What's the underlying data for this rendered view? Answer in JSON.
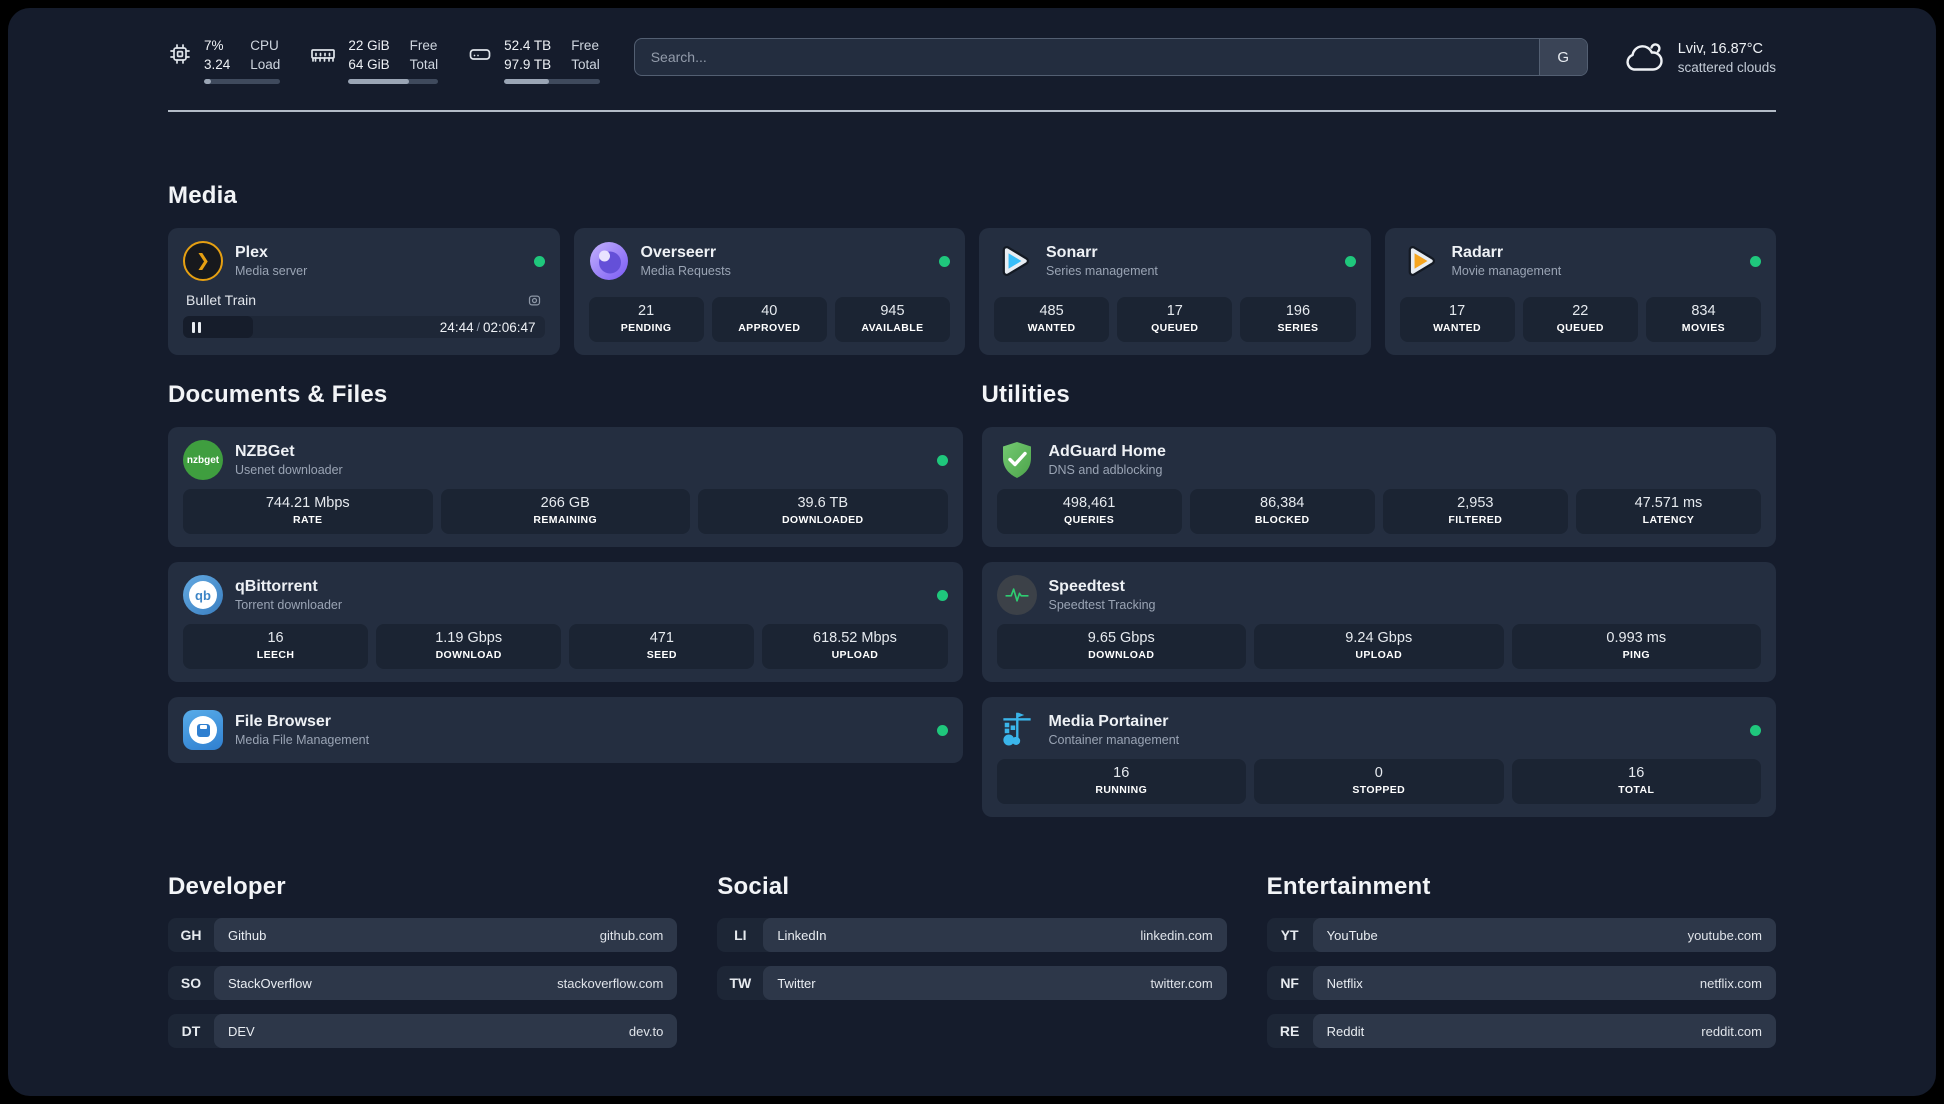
{
  "topbar": {
    "cpu": {
      "icon": "cpu-icon",
      "values": [
        "7%",
        "3.24"
      ],
      "labels": [
        "CPU",
        "Load"
      ],
      "progress_percent": 9
    },
    "memory": {
      "icon": "memory-icon",
      "values": [
        "22 GiB",
        "64 GiB"
      ],
      "labels": [
        "Free",
        "Total"
      ],
      "progress_percent": 67
    },
    "disk": {
      "icon": "hard-drive-icon",
      "values": [
        "52.4 TB",
        "97.9 TB"
      ],
      "labels": [
        "Free",
        "Total"
      ],
      "progress_percent": 47
    },
    "search": {
      "placeholder": "Search...",
      "engine_button": "G"
    },
    "weather": {
      "icon": "cloud-icon",
      "location_temp": "Lviv, 16.87°C",
      "condition": "scattered clouds"
    }
  },
  "colors": {
    "status_online": "#1fc77c",
    "accent_card": "#242e40",
    "accent_tile": "#1b2433"
  },
  "sections": {
    "media": {
      "title": "Media",
      "plex": {
        "name": "Plex",
        "description": "Media server",
        "icon": "plex-icon",
        "status": "online",
        "now_playing": {
          "title": "Bullet Train",
          "time_display_elapsed": "24:44",
          "time_display_total": "02:06:47",
          "separator": "/",
          "progress_percent": 19.5
        }
      },
      "overseerr": {
        "name": "Overseerr",
        "description": "Media Requests",
        "icon": "overseerr-icon",
        "status": "online",
        "stats": [
          {
            "value": "21",
            "label": "PENDING"
          },
          {
            "value": "40",
            "label": "APPROVED"
          },
          {
            "value": "945",
            "label": "AVAILABLE"
          }
        ]
      },
      "sonarr": {
        "name": "Sonarr",
        "description": "Series management",
        "icon": "sonarr-icon",
        "status": "online",
        "stats": [
          {
            "value": "485",
            "label": "WANTED"
          },
          {
            "value": "17",
            "label": "QUEUED"
          },
          {
            "value": "196",
            "label": "SERIES"
          }
        ]
      },
      "radarr": {
        "name": "Radarr",
        "description": "Movie management",
        "icon": "radarr-icon",
        "status": "online",
        "stats": [
          {
            "value": "17",
            "label": "WANTED"
          },
          {
            "value": "22",
            "label": "QUEUED"
          },
          {
            "value": "834",
            "label": "MOVIES"
          }
        ]
      }
    },
    "documents": {
      "title": "Documents & Files",
      "nzbget": {
        "name": "NZBGet",
        "description": "Usenet downloader",
        "icon": "nzbget-icon",
        "status": "online",
        "stats": [
          {
            "value": "744.21 Mbps",
            "label": "RATE"
          },
          {
            "value": "266 GB",
            "label": "REMAINING"
          },
          {
            "value": "39.6 TB",
            "label": "DOWNLOADED"
          }
        ]
      },
      "qbittorrent": {
        "name": "qBittorrent",
        "description": "Torrent downloader",
        "icon": "qbittorrent-icon",
        "status": "online",
        "stats": [
          {
            "value": "16",
            "label": "LEECH"
          },
          {
            "value": "1.19 Gbps",
            "label": "DOWNLOAD"
          },
          {
            "value": "471",
            "label": "SEED"
          },
          {
            "value": "618.52 Mbps",
            "label": "UPLOAD"
          }
        ]
      },
      "filebrowser": {
        "name": "File Browser",
        "description": "Media File Management",
        "icon": "filebrowser-icon",
        "status": "online"
      }
    },
    "utilities": {
      "title": "Utilities",
      "adguard": {
        "name": "AdGuard Home",
        "description": "DNS and adblocking",
        "icon": "adguard-shield-icon",
        "stats": [
          {
            "value": "498,461",
            "label": "QUERIES"
          },
          {
            "value": "86,384",
            "label": "BLOCKED"
          },
          {
            "value": "2,953",
            "label": "FILTERED"
          },
          {
            "value": "47.571 ms",
            "label": "LATENCY"
          }
        ]
      },
      "speedtest": {
        "name": "Speedtest",
        "description": "Speedtest Tracking",
        "icon": "speedtest-pulse-icon",
        "stats": [
          {
            "value": "9.65 Gbps",
            "label": "DOWNLOAD"
          },
          {
            "value": "9.24 Gbps",
            "label": "UPLOAD"
          },
          {
            "value": "0.993 ms",
            "label": "PING"
          }
        ]
      },
      "portainer": {
        "name": "Media Portainer",
        "description": "Container management",
        "icon": "portainer-crane-icon",
        "status": "online",
        "stats": [
          {
            "value": "16",
            "label": "RUNNING"
          },
          {
            "value": "0",
            "label": "STOPPED"
          },
          {
            "value": "16",
            "label": "TOTAL"
          }
        ]
      }
    },
    "bookmarks": [
      {
        "title": "Developer",
        "links": [
          {
            "abbr": "GH",
            "name": "Github",
            "url": "github.com"
          },
          {
            "abbr": "SO",
            "name": "StackOverflow",
            "url": "stackoverflow.com"
          },
          {
            "abbr": "DT",
            "name": "DEV",
            "url": "dev.to"
          }
        ]
      },
      {
        "title": "Social",
        "links": [
          {
            "abbr": "LI",
            "name": "LinkedIn",
            "url": "linkedin.com"
          },
          {
            "abbr": "TW",
            "name": "Twitter",
            "url": "twitter.com"
          }
        ]
      },
      {
        "title": "Entertainment",
        "links": [
          {
            "abbr": "YT",
            "name": "YouTube",
            "url": "youtube.com"
          },
          {
            "abbr": "NF",
            "name": "Netflix",
            "url": "netflix.com"
          },
          {
            "abbr": "RE",
            "name": "Reddit",
            "url": "reddit.com"
          }
        ]
      }
    ]
  }
}
